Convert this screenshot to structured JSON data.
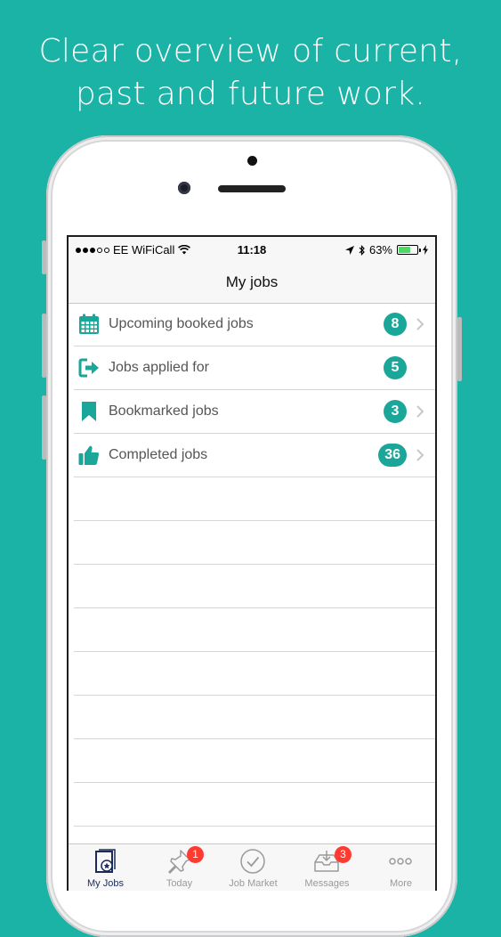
{
  "headline": {
    "line1": "Clear overview of current,",
    "line2": "past and future work."
  },
  "colors": {
    "background": "#1ab3a6",
    "accent": "#1aa698",
    "badge_red": "#ff3b30"
  },
  "status_bar": {
    "carrier": "EE WiFiCall",
    "time": "11:18",
    "battery": "63%",
    "battery_level": 0.63
  },
  "nav": {
    "title": "My jobs"
  },
  "rows": [
    {
      "icon": "calendar-icon",
      "label": "Upcoming booked jobs",
      "count": "8",
      "chevron": true
    },
    {
      "icon": "sign-out-icon",
      "label": "Jobs applied for",
      "count": "5",
      "chevron": false
    },
    {
      "icon": "bookmark-icon",
      "label": "Bookmarked jobs",
      "count": "3",
      "chevron": true
    },
    {
      "icon": "thumbs-up-icon",
      "label": "Completed jobs",
      "count": "36",
      "chevron": true
    }
  ],
  "tabs": [
    {
      "icon": "my-jobs-icon",
      "label": "My Jobs",
      "active": true
    },
    {
      "icon": "pin-icon",
      "label": "Today",
      "badge": "1"
    },
    {
      "icon": "check-circle-icon",
      "label": "Job Market"
    },
    {
      "icon": "inbox-icon",
      "label": "Messages",
      "badge": "3"
    },
    {
      "icon": "more-icon",
      "label": "More"
    }
  ]
}
